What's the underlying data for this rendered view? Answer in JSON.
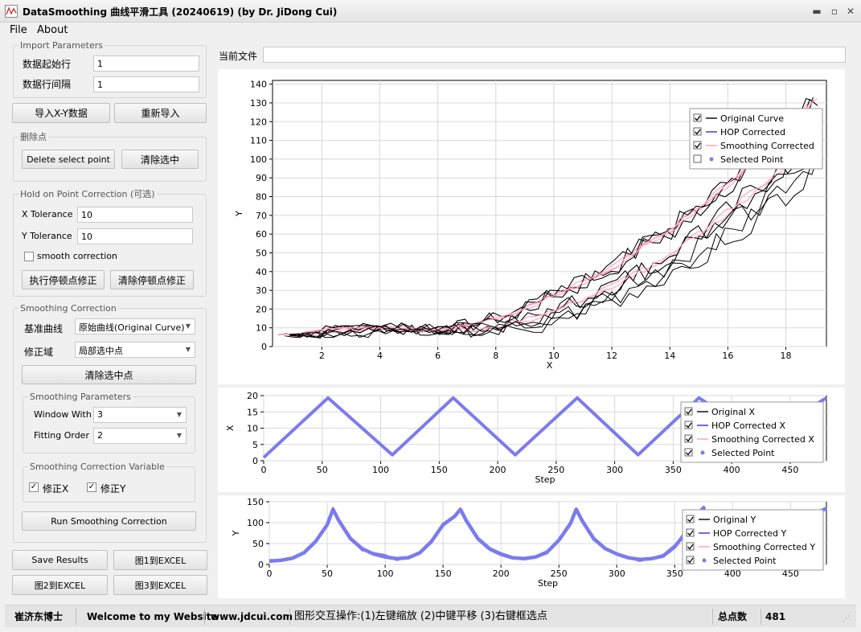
{
  "window": {
    "title": "DataSmoothing 曲线平滑工具 (20240619) (by Dr. JiDong Cui)"
  },
  "menu": {
    "file": "File",
    "about": "About"
  },
  "import_params": {
    "legend": "Import Parameters",
    "start_row_label": "数据起始行",
    "start_row_value": "1",
    "interval_label": "数据行间隔",
    "interval_value": "1"
  },
  "import_buttons": {
    "import_xy": "导入X-Y数据",
    "reimport": "重新导入"
  },
  "delete_points": {
    "legend": "删除点",
    "delete_select": "Delete select point",
    "clear_select": "清除选中"
  },
  "hop": {
    "legend": "Hold on Point Correction (可选)",
    "x_tol_label": "X Tolerance",
    "x_tol_value": "10",
    "y_tol_label": "Y Tolerance",
    "y_tol_value": "10",
    "smooth_label": "smooth correction",
    "smooth_checked": false,
    "run": "执行停顿点修正",
    "clear": "清除停顿点修正"
  },
  "smoothing": {
    "legend": "Smoothing Correction",
    "base_label": "基准曲线",
    "base_value": "原始曲线(Original Curve)",
    "domain_label": "修正域",
    "domain_value": "局部选中点",
    "clear_selected": "清除选中点",
    "params_legend": "Smoothing Parameters",
    "window_label": "Window With",
    "window_value": "3",
    "order_label": "Fitting Order",
    "order_value": "2",
    "var_legend": "Smoothing Correction Variable",
    "fix_x": "修正X",
    "fix_x_checked": true,
    "fix_y": "修正Y",
    "fix_y_checked": true,
    "run": "Run Smoothing Correction"
  },
  "bottom_buttons": {
    "save": "Save Results",
    "fig1": "图1到EXCEL",
    "fig2": "图2到EXCEL",
    "fig3": "图3到EXCEL"
  },
  "current_file": {
    "label": "当前文件",
    "value": ""
  },
  "status": {
    "author": "崔济东博士",
    "welcome": "Welcome to my Website",
    "website": "www.jdcui.com",
    "hint": "图形交互操作:(1)左键缩放 (2)中键平移 (3)右键框选点",
    "total_label": "总点数",
    "total_value": "481"
  },
  "colors": {
    "original": "#000000",
    "hop": "#3030c8",
    "smoothed": "#ff99bb",
    "selected": "#7b7bef",
    "grid": "#d8d8d8"
  },
  "chart_data": [
    {
      "type": "line",
      "xlabel": "X",
      "ylabel": "Y",
      "xlim": [
        0.3,
        19.4
      ],
      "ylim": [
        0,
        142
      ],
      "xticks": [
        2,
        4,
        6,
        8,
        10,
        12,
        14,
        16,
        18
      ],
      "yticks": [
        0,
        10,
        20,
        30,
        40,
        50,
        60,
        70,
        80,
        90,
        100,
        110,
        120,
        130,
        140
      ],
      "legend": [
        "Original Curve",
        "HOP Corrected",
        "Smoothing Corrected",
        "Selected Point"
      ],
      "legend_checked": [
        true,
        true,
        true,
        false
      ],
      "legend_placement": "top-right",
      "series": [
        {
          "name": "Original Curve",
          "note": "noisy zig-zag data approximating y = f(x); sampled",
          "x": [
            0.3,
            1,
            2,
            3,
            4,
            5,
            6,
            7,
            8,
            9,
            10,
            11,
            12,
            13,
            14,
            15,
            16,
            17,
            18,
            19,
            19.4
          ],
          "y": [
            6,
            7,
            9,
            10,
            10,
            9,
            9,
            11,
            15,
            20,
            27,
            34,
            42,
            52,
            62,
            74,
            87,
            100,
            115,
            132,
            140
          ]
        },
        {
          "name": "Smoothing Corrected",
          "x": [
            0.3,
            1,
            2,
            3,
            4,
            5,
            6,
            7,
            8,
            9,
            10,
            11,
            12,
            13,
            14,
            15,
            16,
            17,
            18,
            19,
            19.4
          ],
          "y": [
            6,
            7,
            9,
            10,
            10,
            9,
            9,
            11,
            15,
            20,
            27,
            34,
            42,
            52,
            62,
            74,
            87,
            100,
            115,
            132,
            140
          ]
        }
      ]
    },
    {
      "type": "line",
      "xlabel": "Step",
      "ylabel": "X",
      "xlim": [
        0,
        481
      ],
      "ylim": [
        0,
        20
      ],
      "xticks": [
        0,
        50,
        100,
        150,
        200,
        250,
        300,
        350,
        400,
        450
      ],
      "yticks": [
        0,
        5,
        10,
        15,
        20
      ],
      "legend": [
        "Original X",
        "HOP Corrected X",
        "Smoothing Corrected X",
        "Selected Point"
      ],
      "legend_checked": [
        true,
        true,
        true,
        true
      ],
      "legend_placement": "top-right",
      "series": [
        {
          "name": "Selected Point",
          "x": [
            0,
            55,
            110,
            162,
            215,
            268,
            320,
            372,
            425,
            481
          ],
          "y": [
            1,
            19.3,
            1.8,
            19.3,
            1.8,
            19.3,
            1.8,
            19.3,
            7,
            19.3
          ]
        }
      ]
    },
    {
      "type": "line",
      "xlabel": "Step",
      "ylabel": "Y",
      "xlim": [
        0,
        481
      ],
      "ylim": [
        0,
        150
      ],
      "xticks": [
        0,
        50,
        100,
        150,
        200,
        250,
        300,
        350,
        400,
        450
      ],
      "yticks": [
        0,
        50,
        100,
        150
      ],
      "legend": [
        "Original Y",
        "HOP Corrected Y",
        "Smoothing Corrected Y",
        "Selected Point"
      ],
      "legend_checked": [
        true,
        true,
        true,
        true
      ],
      "legend_placement": "top-right",
      "series": [
        {
          "name": "Selected Point",
          "x": [
            0,
            10,
            20,
            30,
            40,
            50,
            55,
            60,
            70,
            80,
            90,
            100,
            110,
            120,
            130,
            140,
            150,
            160,
            165,
            170,
            180,
            190,
            200,
            210,
            220,
            230,
            240,
            250,
            260,
            265,
            270,
            280,
            290,
            300,
            310,
            320,
            330,
            340,
            350,
            360,
            370,
            375,
            380,
            390,
            400,
            410,
            420,
            430,
            440,
            450,
            460,
            470,
            481
          ],
          "y": [
            8,
            10,
            15,
            28,
            55,
            95,
            132,
            105,
            62,
            38,
            25,
            18,
            14,
            16,
            28,
            55,
            95,
            115,
            132,
            105,
            62,
            38,
            25,
            16,
            14,
            18,
            30,
            58,
            98,
            132,
            105,
            62,
            38,
            25,
            16,
            12,
            14,
            20,
            42,
            78,
            120,
            136,
            22,
            14,
            12,
            14,
            16,
            18,
            40,
            70,
            100,
            120,
            134
          ]
        }
      ]
    }
  ]
}
